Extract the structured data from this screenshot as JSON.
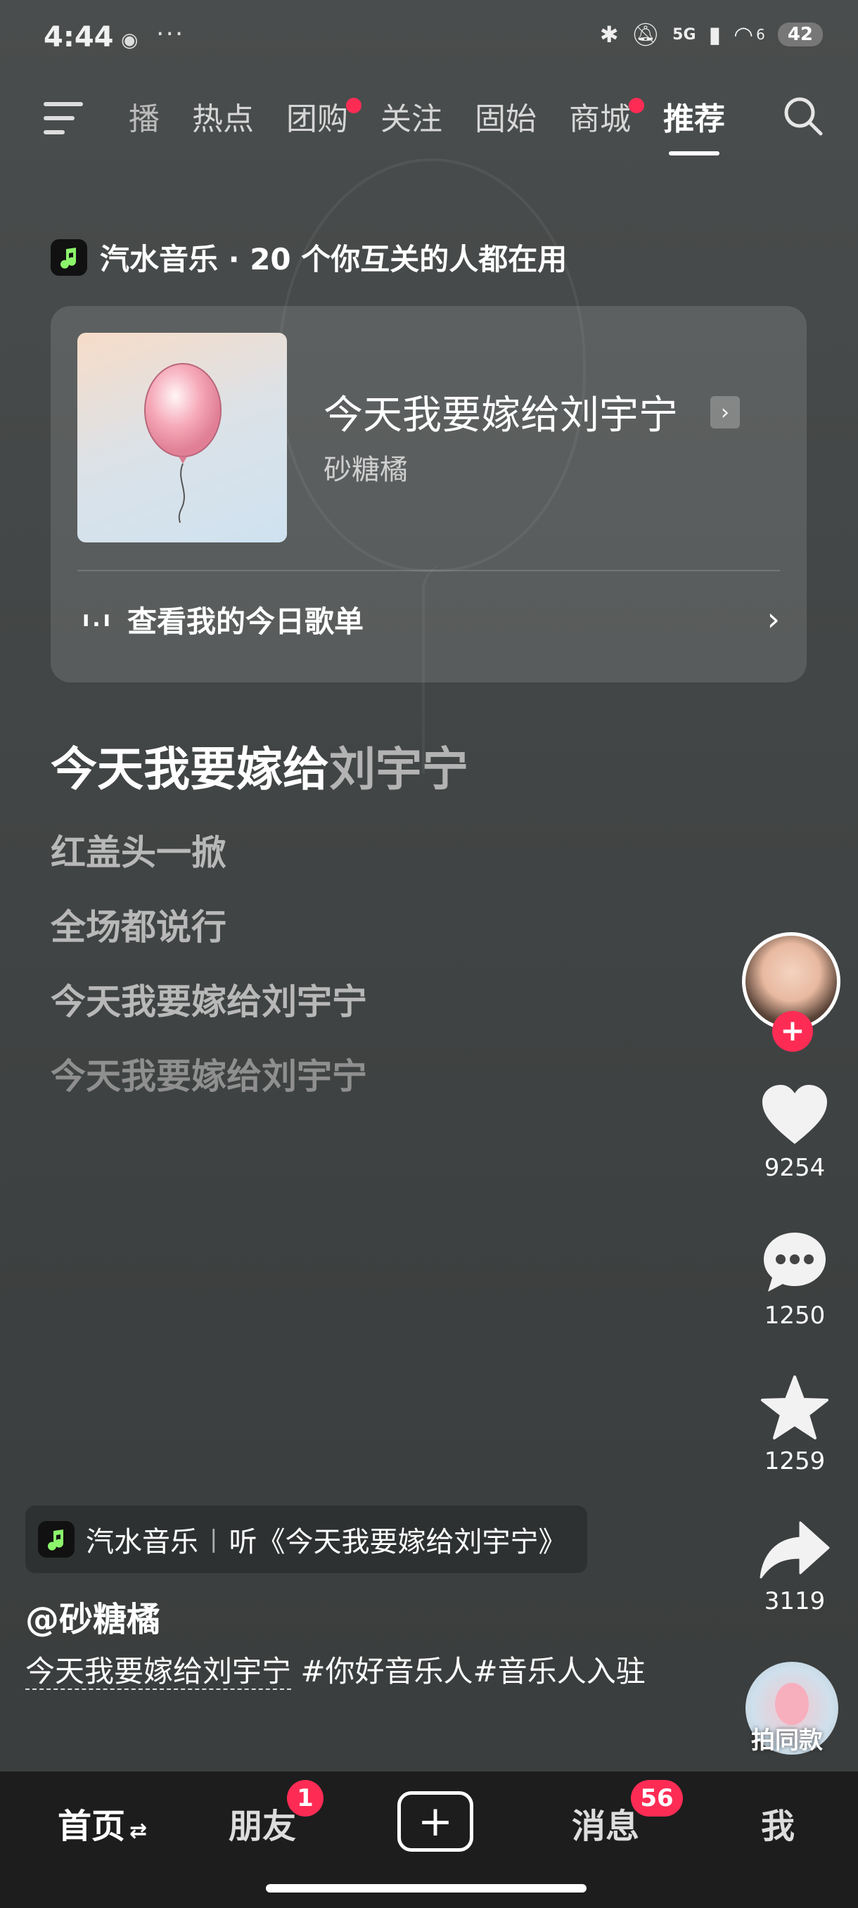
{
  "status_bar": {
    "time": "4:44",
    "dots": "···",
    "network": "5G",
    "wifi_extra": "6",
    "battery": "42"
  },
  "top_nav": {
    "tabs": [
      {
        "label": "播",
        "dot": false
      },
      {
        "label": "热点",
        "dot": false
      },
      {
        "label": "团购",
        "dot": true
      },
      {
        "label": "关注",
        "dot": false
      },
      {
        "label": "固始",
        "dot": false
      },
      {
        "label": "商城",
        "dot": true
      },
      {
        "label": "推荐",
        "dot": false,
        "active": true
      }
    ]
  },
  "music_header": {
    "text": "汽水音乐 · 20 个你互关的人都在用"
  },
  "song_card": {
    "title": "今天我要嫁给刘宇宁",
    "artist": "砂糖橘",
    "playlist_label": "查看我的今日歌单",
    "bars": "ı.ı"
  },
  "lyrics": {
    "current_highlight": "今天我要嫁给",
    "current_rest": "刘宇宁",
    "lines": [
      "红盖头一掀",
      "全场都说行",
      "今天我要嫁给刘宇宁",
      "今天我要嫁给刘宇宁"
    ]
  },
  "actions": {
    "follow_plus": "+",
    "likes": "9254",
    "comments": "1250",
    "favorites": "1259",
    "shares": "3119",
    "same_style_label": "拍同款"
  },
  "post": {
    "music_app": "汽水音乐",
    "separator": "|",
    "listen_text": "听《今天我要嫁给刘宇宁》",
    "author": "@砂糖橘",
    "desc_link": "今天我要嫁给刘宇宁",
    "desc_tags": " #你好音乐人#音乐人入驻"
  },
  "bottom_nav": {
    "home": "首页",
    "home_suffix": "⇄",
    "friends": "朋友",
    "friends_badge": "1",
    "create": "+",
    "messages": "消息",
    "messages_badge": "56",
    "me": "我"
  },
  "colors": {
    "accent": "#fe2c55",
    "background": "#3f4242",
    "nav_background": "#1d1d1d"
  }
}
